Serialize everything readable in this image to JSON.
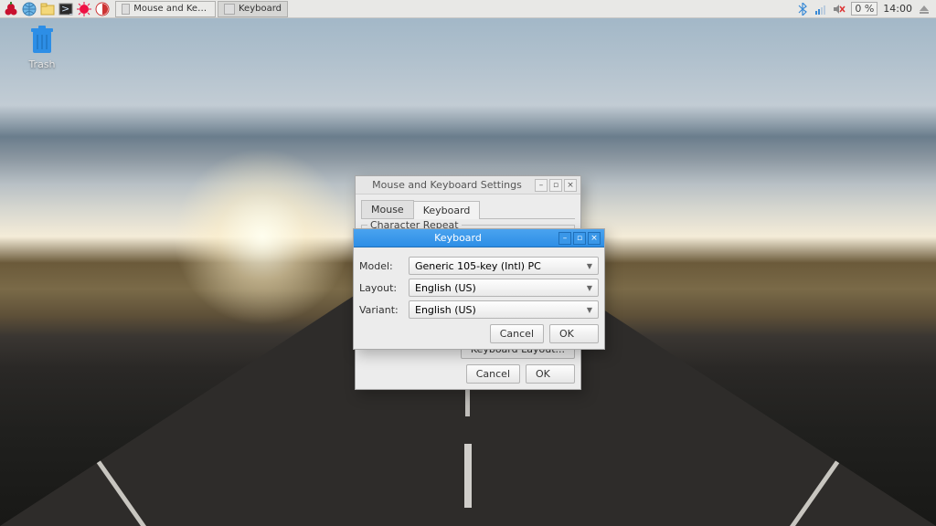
{
  "taskbar": {
    "windows": [
      {
        "label": "Mouse and Keyboard..."
      },
      {
        "label": "Keyboard"
      }
    ],
    "tray": {
      "cpu": "0 %",
      "clock": "14:00"
    }
  },
  "desktop": {
    "trash_label": "Trash"
  },
  "settings_window": {
    "title": "Mouse and Keyboard Settings",
    "tabs": {
      "mouse": "Mouse",
      "keyboard": "Keyboard"
    },
    "group_label": "Character Repeat",
    "keyboard_layout_btn": "Keyboard Layout...",
    "cancel": "Cancel",
    "ok": "OK"
  },
  "keyboard_dialog": {
    "title": "Keyboard",
    "model_label": "Model:",
    "layout_label": "Layout:",
    "variant_label": "Variant:",
    "model_value": "Generic 105-key (Intl) PC",
    "layout_value": "English (US)",
    "variant_value": "English (US)",
    "cancel": "Cancel",
    "ok": "OK"
  }
}
